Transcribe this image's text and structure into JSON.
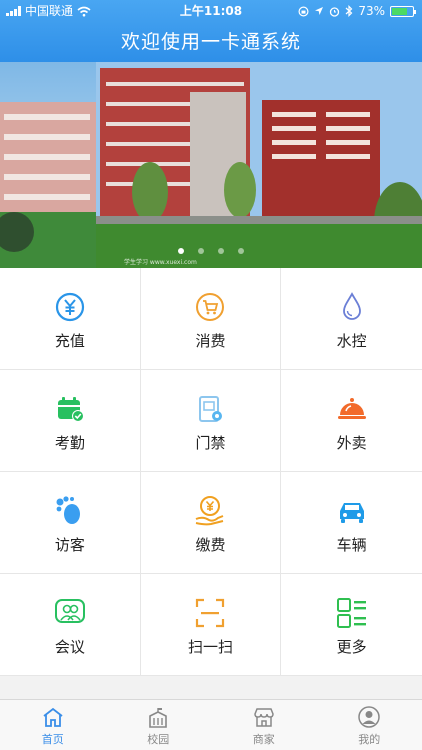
{
  "status_bar": {
    "carrier": "中国联通",
    "time": "上午11:08",
    "battery": "73%"
  },
  "header": {
    "title": "欢迎使用一卡通系统"
  },
  "banner": {
    "dots": 4,
    "active_index": 0,
    "image_caption": "学生学习 www.xuexi.com"
  },
  "grid": [
    {
      "label": "充值",
      "icon": "yuan-coin-icon",
      "color": "#2a95e8"
    },
    {
      "label": "消费",
      "icon": "shopping-cart-icon",
      "color": "#f0a030"
    },
    {
      "label": "水控",
      "icon": "water-drop-icon",
      "color": "#6b7fd6"
    },
    {
      "label": "考勤",
      "icon": "calendar-check-icon",
      "color": "#28c060"
    },
    {
      "label": "门禁",
      "icon": "door-access-icon",
      "color": "#58b6f0"
    },
    {
      "label": "外卖",
      "icon": "food-cloche-icon",
      "color": "#f26a2a"
    },
    {
      "label": "访客",
      "icon": "footprint-icon",
      "color": "#3a9ef0"
    },
    {
      "label": "缴费",
      "icon": "payment-hand-icon",
      "color": "#f0a020"
    },
    {
      "label": "车辆",
      "icon": "car-icon",
      "color": "#1f9be8"
    },
    {
      "label": "会议",
      "icon": "meeting-people-icon",
      "color": "#28c060"
    },
    {
      "label": "扫一扫",
      "icon": "scan-icon",
      "color": "#f0a030"
    },
    {
      "label": "更多",
      "icon": "more-grid-icon",
      "color": "#2fbf50"
    }
  ],
  "tabbar": [
    {
      "label": "首页",
      "icon": "home-icon",
      "active": true
    },
    {
      "label": "校园",
      "icon": "campus-building-icon",
      "active": false
    },
    {
      "label": "商家",
      "icon": "shop-icon",
      "active": false
    },
    {
      "label": "我的",
      "icon": "user-icon",
      "active": false
    }
  ]
}
